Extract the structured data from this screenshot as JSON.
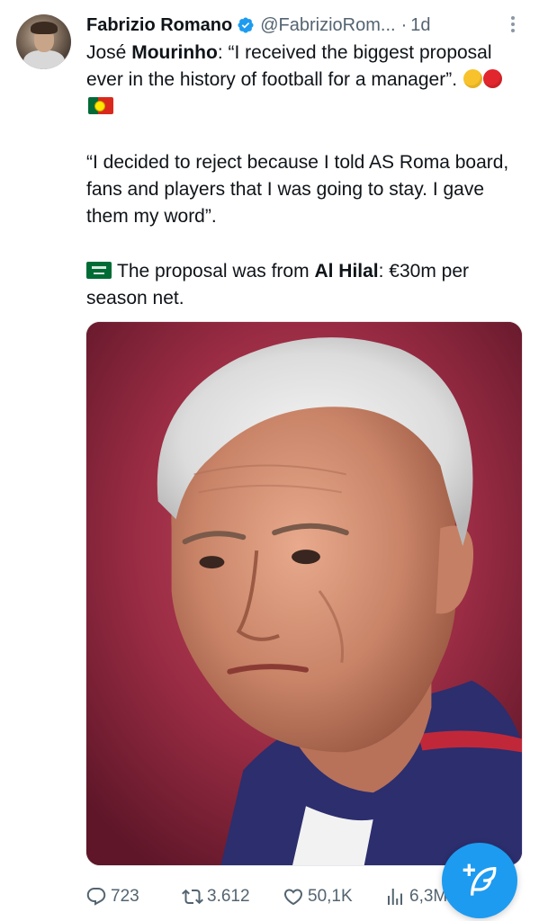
{
  "author": {
    "display_name": "Fabrizio Romano",
    "handle": "@FabrizioRom...",
    "separator": "·",
    "time": "1d",
    "verified": true,
    "verified_color": "#1d9bf0"
  },
  "tweet": {
    "p1_prefix": "José ",
    "p1_bold": "Mourinho",
    "p1_text": ": “I received the biggest proposal ever in the history of football for a manager”.",
    "p1_emojis": [
      "yellow-circle",
      "red-circle",
      "portugal-flag"
    ],
    "p2_text": "“I decided to reject because I told AS Roma board, fans and players that I was going to stay. I gave them my word”.",
    "p3_emoji": "saudi-arabia-flag",
    "p3_prefix": "The proposal was from ",
    "p3_bold": "Al Hilal",
    "p3_text": ": €30m per season net."
  },
  "actions": {
    "replies": "723",
    "retweets": "3.612",
    "likes": "50,1K",
    "views": "6,3M"
  },
  "colors": {
    "text": "#0f1419",
    "secondary": "#536471",
    "accent": "#1d9bf0"
  },
  "icons": [
    "more-icon",
    "verified-badge-icon",
    "reply-icon",
    "retweet-icon",
    "like-icon",
    "views-icon",
    "compose-icon"
  ]
}
